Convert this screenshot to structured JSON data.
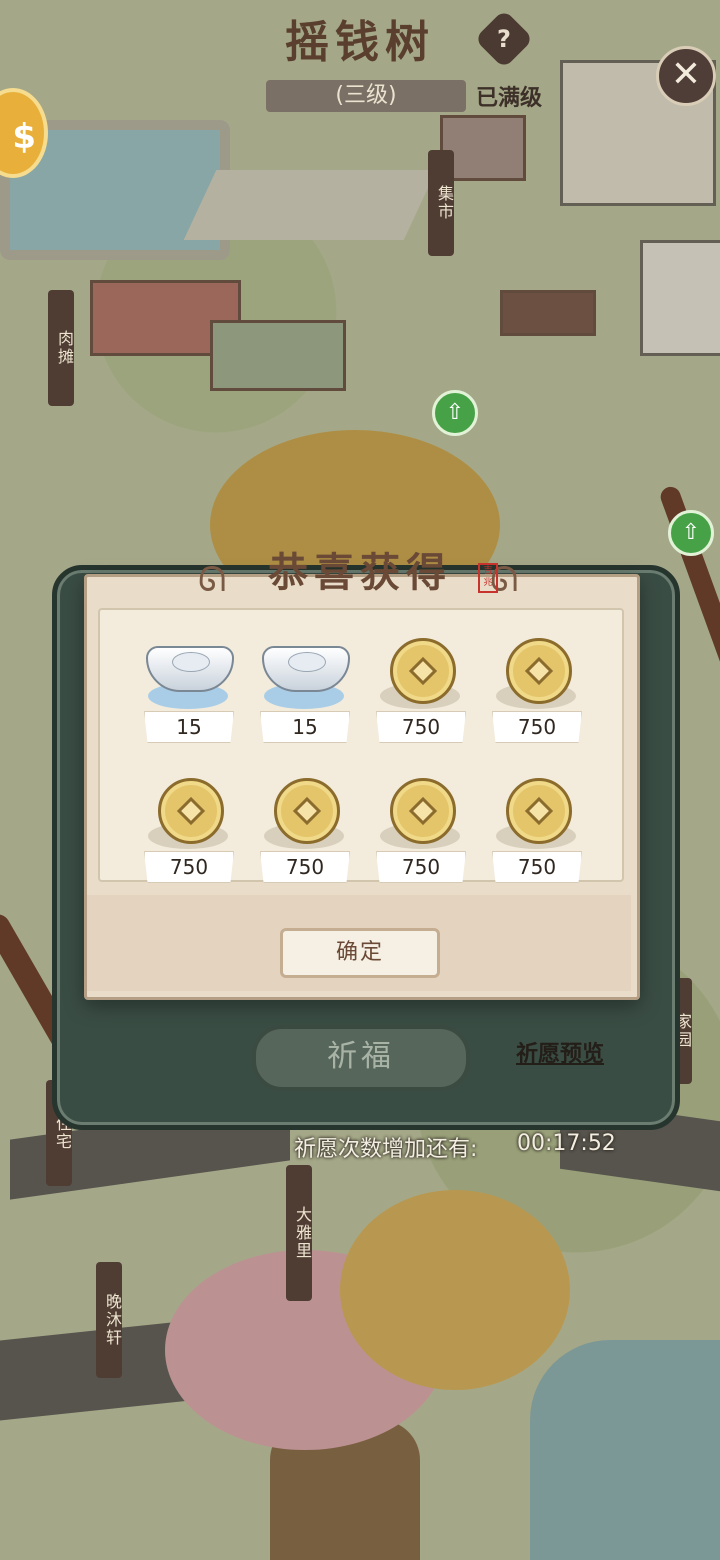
{
  "header": {
    "title": "摇钱树",
    "help_icon": "?",
    "close_icon": "✕",
    "level": "(三级)",
    "level_status": "已满级"
  },
  "map_signs": [
    "集市",
    "肉摊",
    "大雅里",
    "晚沐轩",
    "住宅",
    "家园"
  ],
  "reward_popup": {
    "title": "恭喜获得",
    "seal_text": "吉兆",
    "items": [
      {
        "type": "silver-ingot",
        "amount": "15"
      },
      {
        "type": "silver-ingot",
        "amount": "15"
      },
      {
        "type": "copper-coin",
        "amount": "750"
      },
      {
        "type": "copper-coin",
        "amount": "750"
      },
      {
        "type": "copper-coin",
        "amount": "750"
      },
      {
        "type": "copper-coin",
        "amount": "750"
      },
      {
        "type": "copper-coin",
        "amount": "750"
      },
      {
        "type": "copper-coin",
        "amount": "750"
      }
    ],
    "confirm_label": "确定"
  },
  "wish_panel": {
    "pray_label": "祈福",
    "preview_label": "祈愿预览",
    "timer_label": "祈愿次数增加还有:",
    "timer_value": "00:17:52"
  },
  "colors": {
    "title_brown": "#5a3f2f",
    "panel_green": "#3a4d44",
    "popup_cream": "#e9dcc8",
    "coin_gold": "#e4c56a",
    "upgrade_green": "#47a247"
  }
}
